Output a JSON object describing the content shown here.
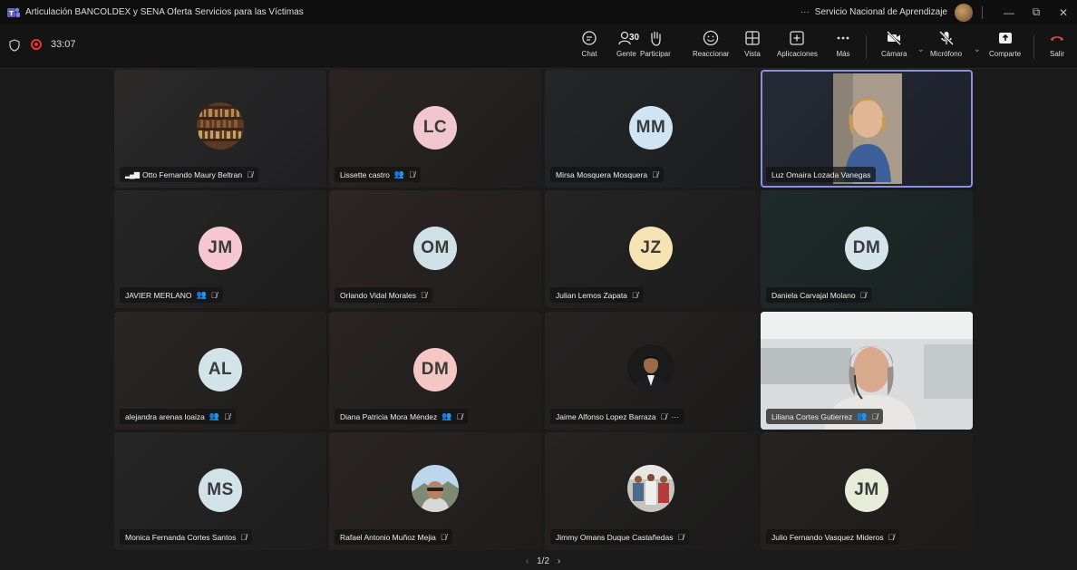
{
  "window": {
    "title": "Articulación BANCOLDEX y SENA Oferta Servicios para las Víctimas",
    "more": "···",
    "org": "Servicio Nacional de Aprendizaje",
    "minimize": "—",
    "restore": "⧉",
    "close": "✕"
  },
  "meeting": {
    "timer": "33:07",
    "people_count": "30"
  },
  "toolbar": {
    "chat": "Chat",
    "people": "Gente",
    "raise_hand": "Participar",
    "react": "Reaccionar",
    "view": "Vista",
    "apps": "Aplicaciones",
    "more": "Más",
    "camera": "Cámara",
    "mic": "Micrófono",
    "share": "Comparte",
    "leave": "Salir",
    "caret": "⌄"
  },
  "participants": [
    {
      "name": "Otto Fernando Maury Beltran",
      "initials": "",
      "signal": "▂▄▆",
      "icons": [
        "mic-off"
      ]
    },
    {
      "name": "Lissette castro",
      "initials": "LC",
      "color": "#f2c6cf",
      "icons": [
        "people",
        "mic-off"
      ]
    },
    {
      "name": "Mirsa Mosquera Mosquera",
      "initials": "MM",
      "color": "#cfe4f4",
      "icons": [
        "mic-off"
      ]
    },
    {
      "name": "Luz Omaira Lozada Vanegas",
      "initials": "",
      "icons": []
    },
    {
      "name": "JAVIER MERLANO",
      "initials": "JM",
      "color": "#f7c6d4",
      "icons": [
        "people",
        "mic-off"
      ]
    },
    {
      "name": "Orlando Vidal Morales",
      "initials": "OM",
      "color": "#cfe1e6",
      "icons": [
        "mic-off"
      ]
    },
    {
      "name": "Julian Lemos Zapata",
      "initials": "JZ",
      "color": "#f6e3b3",
      "icons": [
        "mic-off"
      ]
    },
    {
      "name": "Daniela Carvajal Molano",
      "initials": "DM",
      "color": "#d4e4ea",
      "icons": [
        "mic-off"
      ]
    },
    {
      "name": "alejandra arenas loaiza",
      "initials": "AL",
      "color": "#d2e3ea",
      "icons": [
        "people",
        "mic-off"
      ]
    },
    {
      "name": "Diana Patricia Mora Méndez",
      "initials": "DM",
      "color": "#f5c7c4",
      "icons": [
        "people",
        "mic-off"
      ]
    },
    {
      "name": "Jaime Alfonso Lopez Barraza",
      "initials": "",
      "icons": [
        "mic-off",
        "more"
      ]
    },
    {
      "name": "Liliana Cortes Gutierrez",
      "initials": "",
      "icons": [
        "people",
        "mic-off"
      ]
    },
    {
      "name": "Monica Fernanda Cortes Santos",
      "initials": "MS",
      "color": "#d2e2ea",
      "icons": [
        "mic-off"
      ]
    },
    {
      "name": "Rafael Antonio Muñoz Mejia",
      "initials": "",
      "icons": [
        "mic-off"
      ]
    },
    {
      "name": "Jimmy Omans Duque Castañedas",
      "initials": "",
      "icons": [
        "mic-off"
      ]
    },
    {
      "name": "Julio Fernando Vasquez Mideros",
      "initials": "JM",
      "color": "#e6ecd8",
      "icons": [
        "mic-off"
      ]
    }
  ],
  "pager": {
    "prev": "‹",
    "label": "1/2",
    "next": "›"
  }
}
